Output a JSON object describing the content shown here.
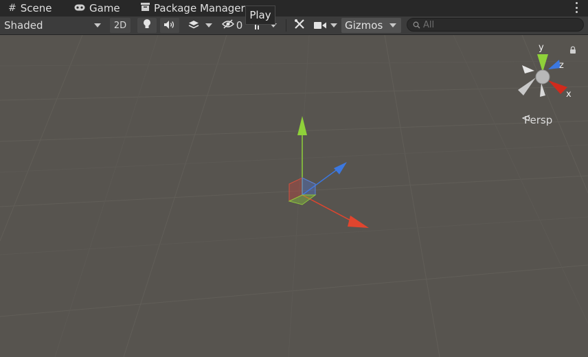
{
  "tabs": [
    {
      "label": "Scene",
      "icon": "grid-icon"
    },
    {
      "label": "Game",
      "icon": "gamepad-icon"
    },
    {
      "label": "Package Manager",
      "icon": "package-icon"
    }
  ],
  "tooltip": {
    "text": "Play"
  },
  "toolbar": {
    "shading_mode": "Shaded",
    "mode_2d_label": "2D",
    "hidden_count": "0",
    "gizmos_label": "Gizmos",
    "search_placeholder": "All"
  },
  "scene": {
    "projection_label": "Persp",
    "orientation_axes": {
      "x": "x",
      "y": "y",
      "z": "z"
    },
    "colors": {
      "x_axis": "#e0452e",
      "y_axis": "#8fd13a",
      "z_axis": "#3c78e0",
      "background": "#57544f"
    }
  }
}
